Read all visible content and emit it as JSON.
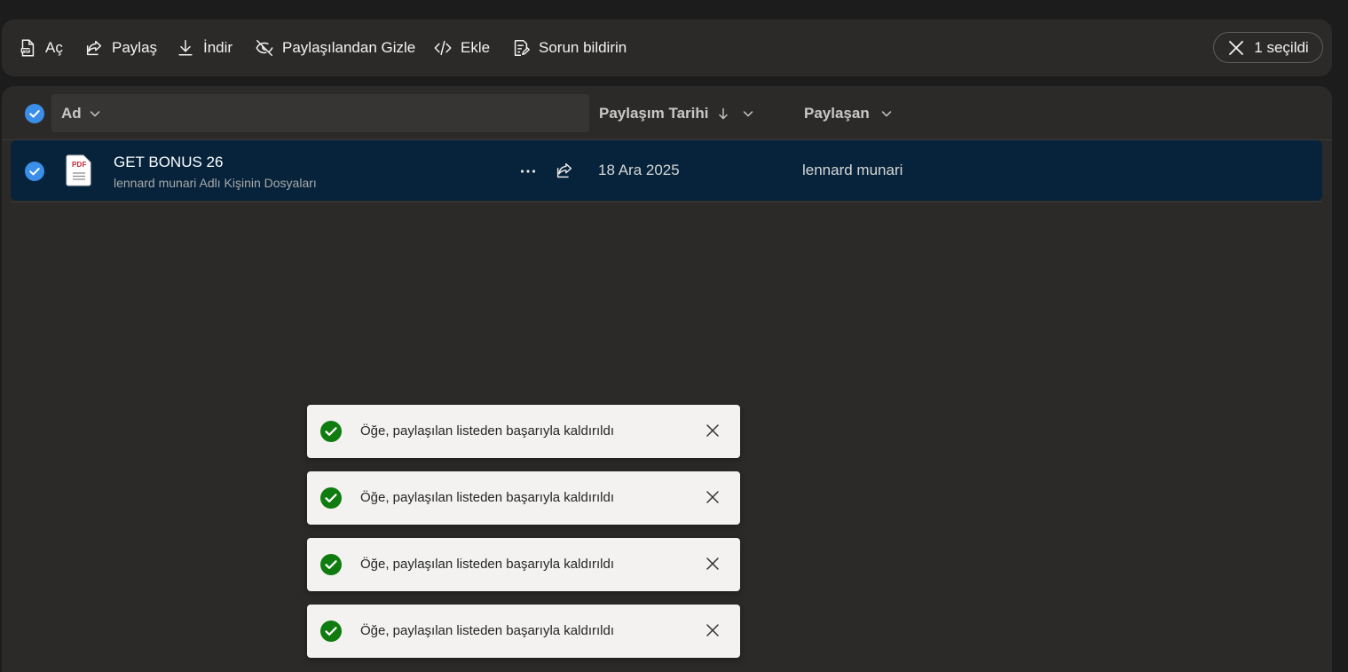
{
  "toolbar": {
    "open_label": "Aç",
    "share_label": "Paylaş",
    "download_label": "İndir",
    "hide_label": "Paylaşılandan Gizle",
    "embed_label": "Ekle",
    "report_label": "Sorun bildirin",
    "selected_label": "1 seçildi"
  },
  "list": {
    "columns": {
      "name": "Ad",
      "shared_date": "Paylaşım Tarihi",
      "shared_by": "Paylaşan"
    },
    "rows": [
      {
        "name": "GET BONUS 26",
        "subtitle": "lennard munari Adlı Kişinin Dosyaları",
        "file_icon_text": "PDF",
        "shared_date": "18 Ara 2025",
        "shared_by": "lennard munari",
        "selected": true
      }
    ]
  },
  "toasts": [
    {
      "message": "Öğe, paylaşılan listeden başarıyla kaldırıldı"
    },
    {
      "message": "Öğe, paylaşılan listeden başarıyla kaldırıldı"
    },
    {
      "message": "Öğe, paylaşılan listeden başarıyla kaldırıldı"
    },
    {
      "message": "Öğe, paylaşılan listeden başarıyla kaldırıldı"
    }
  ],
  "colors": {
    "accent_blue": "#3b8ee8",
    "success_green": "#107c10",
    "selected_row": "#06233b",
    "pdf_red": "#c4262e"
  },
  "icons": [
    "pdf-file-icon",
    "share-icon",
    "download-icon",
    "hide-icon",
    "code-icon",
    "report-icon",
    "close-icon",
    "checkmark-circle-icon",
    "chevron-down-icon",
    "sort-down-arrow-icon",
    "more-options-icon",
    "success-check-icon"
  ]
}
